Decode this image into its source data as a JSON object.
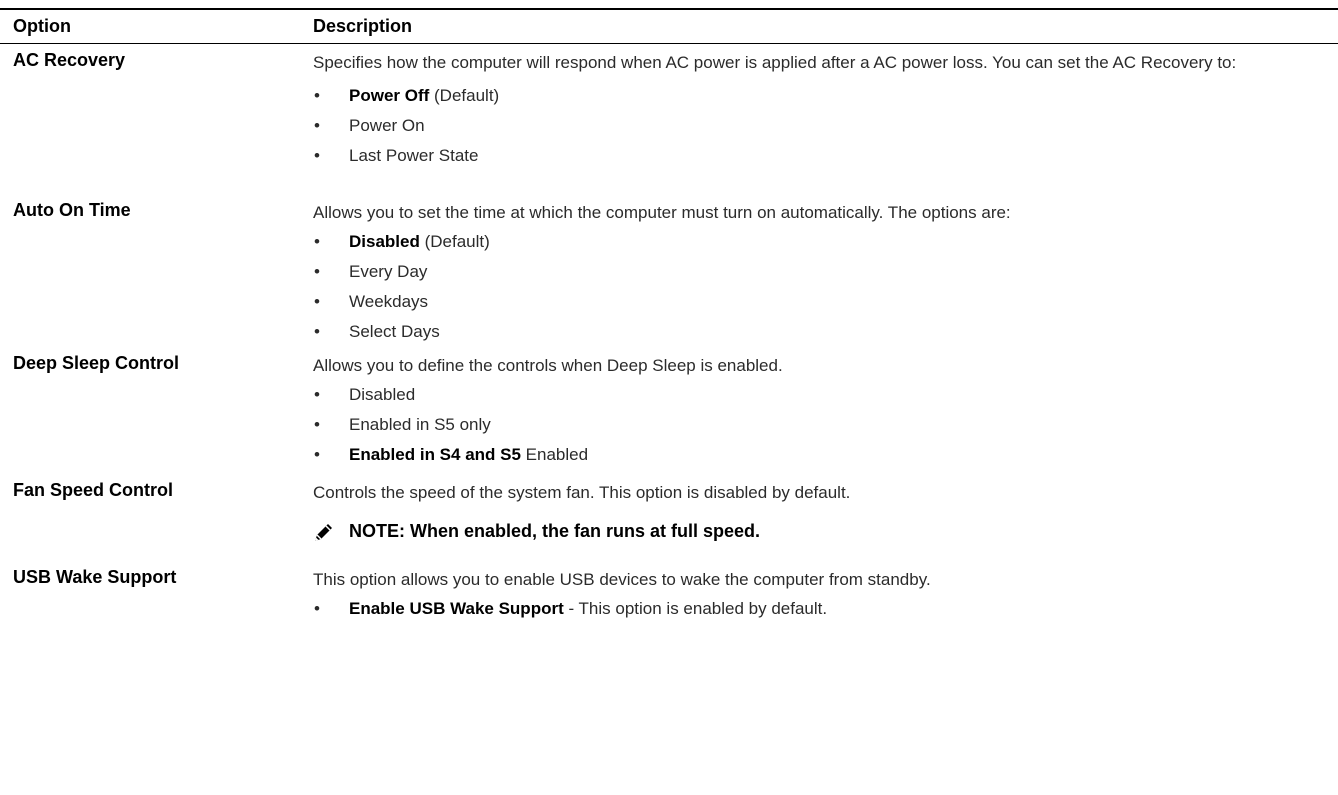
{
  "header": {
    "option": "Option",
    "description": "Description"
  },
  "rows": [
    {
      "option": "AC Recovery",
      "description": "Specifies how the computer will respond when AC power is applied after a AC power loss. You can set the AC Recovery to:",
      "items": [
        {
          "bold": "Power Off",
          "text": " (Default)"
        },
        {
          "bold": "",
          "text": "Power On"
        },
        {
          "bold": "",
          "text": "Last Power State"
        }
      ]
    },
    {
      "option": "Auto On Time",
      "description": "Allows you to set the time at which the computer must turn on automatically. The options are:",
      "items": [
        {
          "bold": "Disabled",
          "text": " (Default)"
        },
        {
          "bold": "",
          "text": "Every Day"
        },
        {
          "bold": "",
          "text": "Weekdays"
        },
        {
          "bold": "",
          "text": "Select Days"
        }
      ]
    },
    {
      "option": "Deep Sleep Control",
      "description": "Allows you to define the controls when Deep Sleep is enabled.",
      "items": [
        {
          "bold": "",
          "text": "Disabled"
        },
        {
          "bold": "",
          "text": "Enabled in S5 only"
        },
        {
          "bold": "Enabled in S4 and S5",
          "text": " Enabled"
        }
      ]
    },
    {
      "option": "Fan Speed Control",
      "description": "Controls the speed of the system fan. This option is disabled by default.",
      "note": "NOTE: When enabled, the fan runs at full speed."
    },
    {
      "option": "USB Wake Support",
      "description": "This option allows you to enable USB devices to wake the computer from standby.",
      "items": [
        {
          "bold": "Enable USB Wake Support",
          "text": " - This option is enabled by default."
        }
      ]
    }
  ],
  "bullet_glyph": "•",
  "note_icon": "pencil-note-icon"
}
